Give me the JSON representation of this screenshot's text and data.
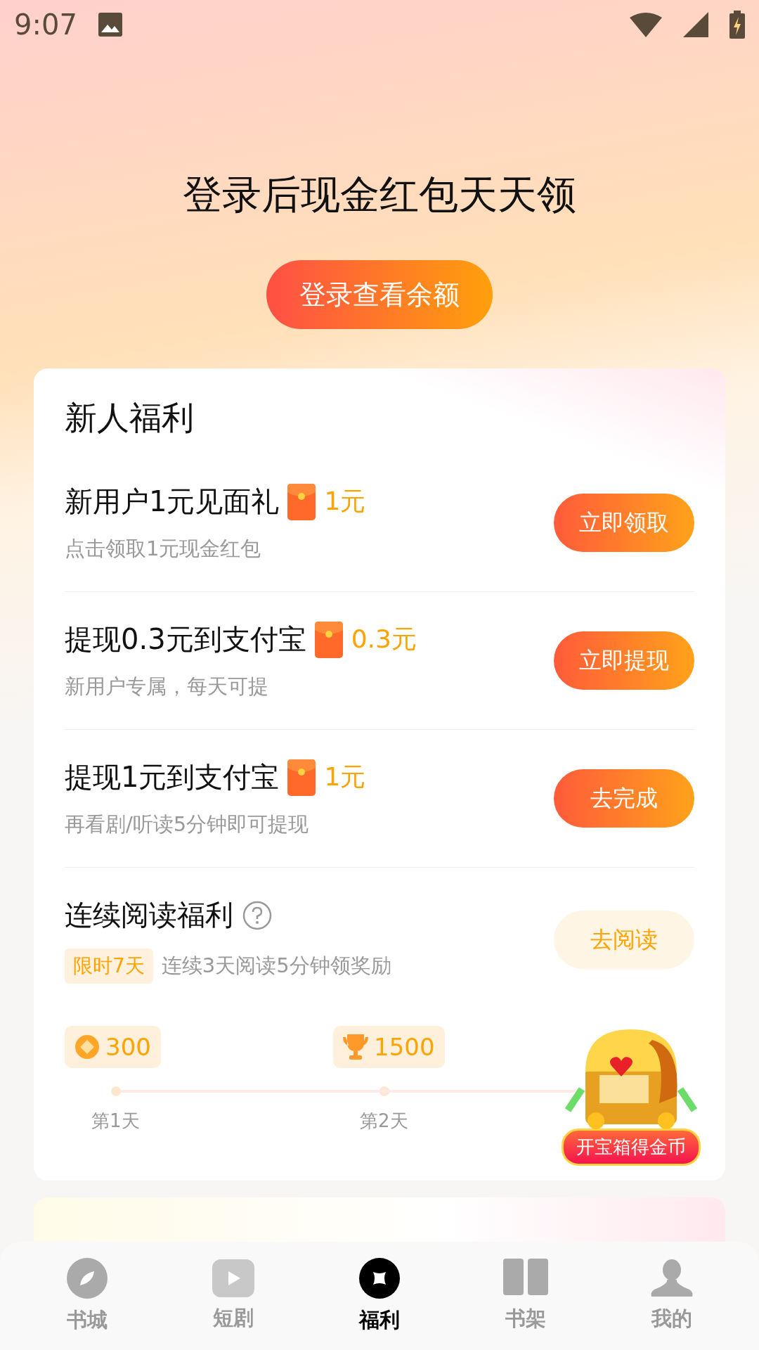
{
  "status_bar": {
    "time": "9:07"
  },
  "hero": {
    "title": "登录后现金红包天天领",
    "button": "登录查看余额"
  },
  "card": {
    "title": "新人福利",
    "tasks": [
      {
        "title": "新用户1元见面礼",
        "amount": "1元",
        "subtitle": "点击领取1元现金红包",
        "button": "立即领取"
      },
      {
        "title": "提现0.3元到支付宝",
        "amount": "0.3元",
        "subtitle": "新用户专属，每天可提",
        "button": "立即提现"
      },
      {
        "title": "提现1元到支付宝",
        "amount": "1元",
        "subtitle": "再看剧/听读5分钟即可提现",
        "button": "去完成"
      }
    ],
    "streak": {
      "title": "连续阅读福利",
      "tag": "限时7天",
      "subtitle": "连续3天阅读5分钟领奖励",
      "button": "去阅读",
      "rewards": [
        {
          "kind": "coin",
          "amount": "300",
          "day": "第1天"
        },
        {
          "kind": "trophy",
          "amount": "1500",
          "day": "第2天"
        }
      ],
      "chest_label": "开宝箱得金币"
    }
  },
  "nav": [
    {
      "kind": "leaf",
      "label": "书城",
      "selected": false
    },
    {
      "kind": "play",
      "label": "短剧",
      "selected": false
    },
    {
      "kind": "star",
      "label": "福利",
      "selected": true
    },
    {
      "kind": "book",
      "label": "书架",
      "selected": false
    },
    {
      "kind": "person",
      "label": "我的",
      "selected": false
    }
  ]
}
